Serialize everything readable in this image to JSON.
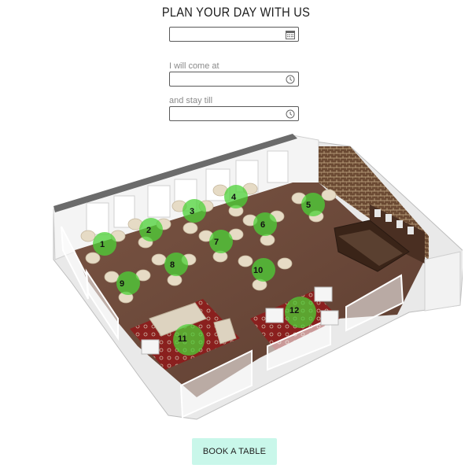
{
  "header": {
    "title": "PLAN YOUR DAY WITH US"
  },
  "form": {
    "date": {
      "value": "",
      "icon": "calendar-icon"
    },
    "arrival": {
      "label": "I will come at",
      "value": "",
      "icon": "clock-icon"
    },
    "departure": {
      "label": "and stay till",
      "value": "",
      "icon": "clock-icon"
    }
  },
  "floorplan": {
    "tables": [
      {
        "number": "1"
      },
      {
        "number": "2"
      },
      {
        "number": "3"
      },
      {
        "number": "4"
      },
      {
        "number": "5"
      },
      {
        "number": "6"
      },
      {
        "number": "7"
      },
      {
        "number": "8"
      },
      {
        "number": "9"
      },
      {
        "number": "10"
      },
      {
        "number": "11"
      },
      {
        "number": "12"
      }
    ]
  },
  "actions": {
    "book_label": "BOOK A TABLE"
  },
  "colors": {
    "button_bg": "#c9f7ea",
    "table_highlight": "#4cd137",
    "floor": "#6e4a3a",
    "rug": "#8e1b1b"
  }
}
